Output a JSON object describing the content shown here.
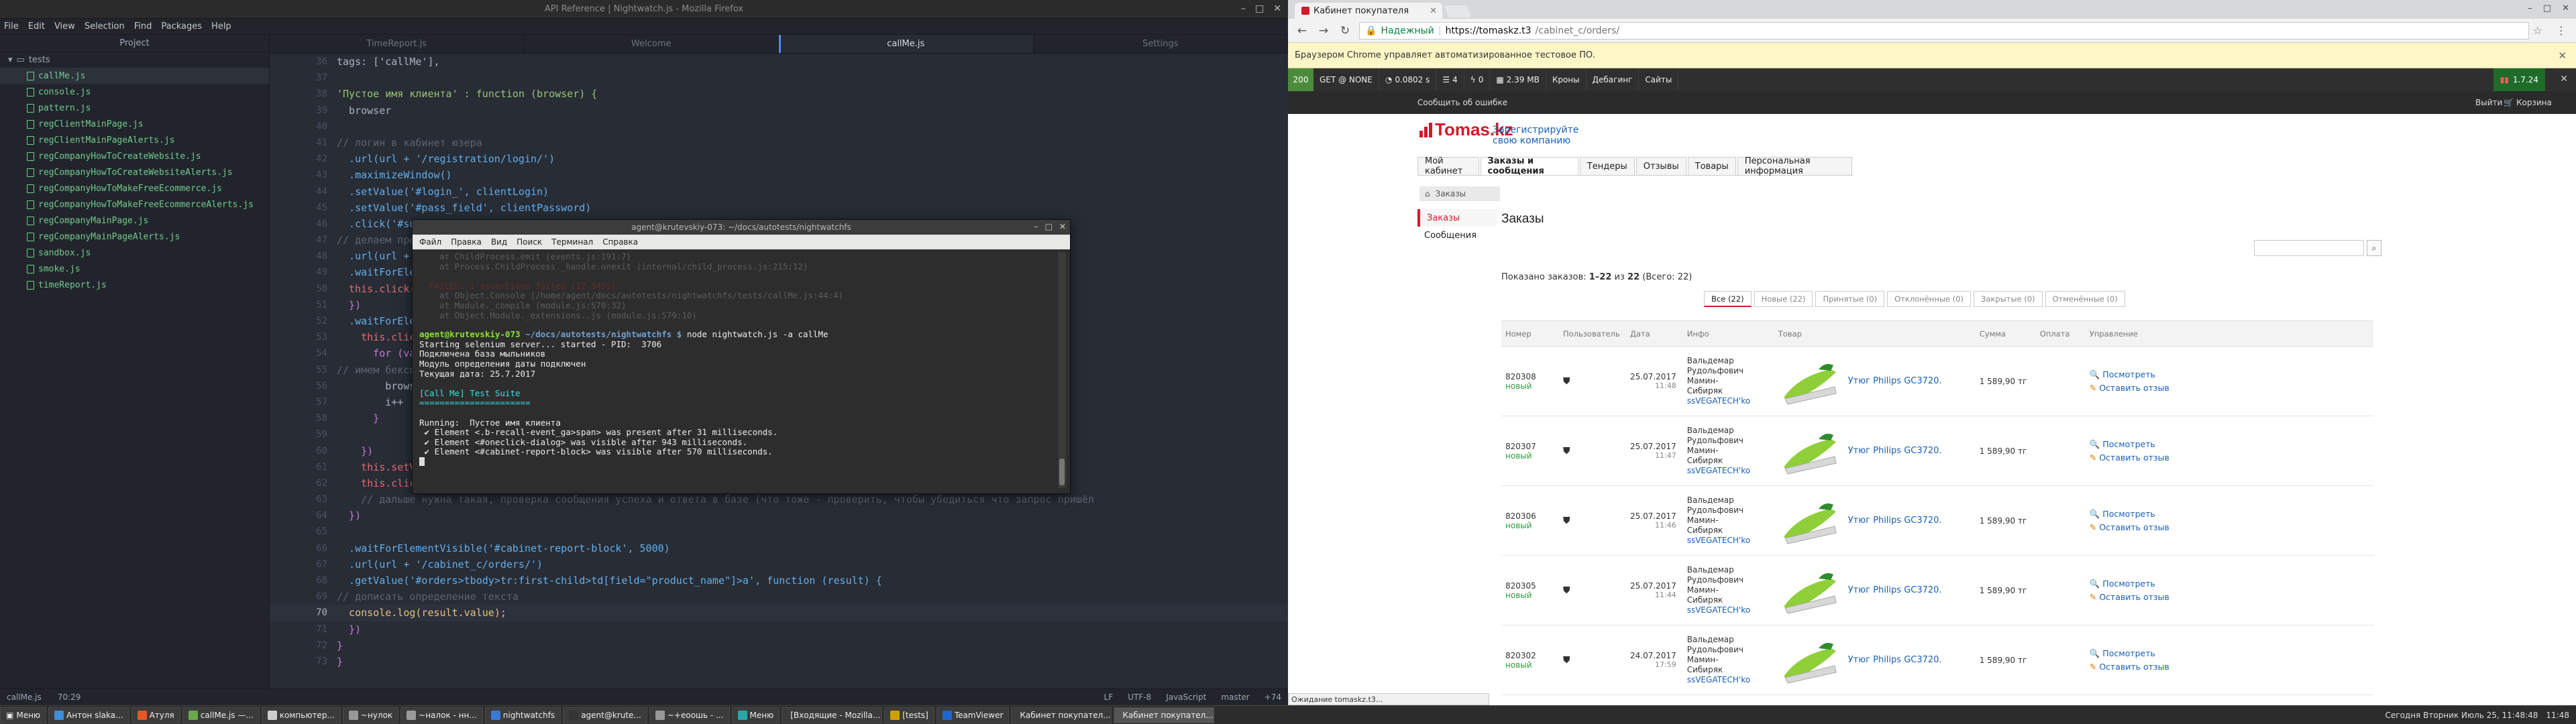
{
  "atom": {
    "title": "API Reference | Nightwatch.js - Mozilla Firefox",
    "menu": [
      "File",
      "Edit",
      "View",
      "Selection",
      "Find",
      "Packages",
      "Help"
    ],
    "tree_header": "Project",
    "tree_folder": "tests",
    "files": [
      "callMe.js",
      "console.js",
      "pattern.js",
      "regClientMainPage.js",
      "regClientMainPageAlerts.js",
      "regCompanyHowToCreateWebsite.js",
      "regCompanyHowToCreateWebsiteAlerts.js",
      "regCompanyHowToMakeFreeEcommerce.js",
      "regCompanyHowToMakeFreeEcommerceAlerts.js",
      "regCompanyMainPage.js",
      "regCompanyMainPageAlerts.js",
      "sandbox.js",
      "smoke.js",
      "timeReport.js"
    ],
    "tabs": [
      "TimeReport.js",
      "Welcome",
      "callMe.js",
      "Settings"
    ],
    "line_numbers": [
      "36",
      "37",
      "38",
      "39",
      "40",
      "41",
      "42",
      "43",
      "44",
      "45",
      "46",
      "47",
      "48",
      "49",
      "50",
      "51",
      "52",
      "53",
      "54",
      "55",
      "56",
      "57",
      "58",
      "59",
      "60",
      "61",
      "62",
      "63",
      "64",
      "65",
      "66",
      "67",
      "68",
      "69",
      "70",
      "71",
      "72",
      "73"
    ],
    "code": [
      "tags: ['callMe'],",
      "",
      "'Пустое имя клиента' : function (browser) {",
      "  browser",
      "",
      "// логин в кабинет юзера",
      "  .url(url + '/registration/login/')",
      "  .maximizeWindow()",
      "  .setValue('#login_', clientLogin)",
      "  .setValue('#pass_field', clientPassword)",
      "  .click('#submi",
      "// делаем провер",
      "  .url(url + targ",
      "  .waitForElement",
      "  this.click('.b",
      "  })",
      "  .waitForElement",
      "    this.click('#",
      "      for (var i",
      "// имем бексплс",
      "        browser.k",
      "        i++",
      "      }",
      "",
      "    })",
      "    this.setValue",
      "    this.click('#",
      "    // дальше нужна такая, проверка сообщения успеха и ответа в базе (что тоже - проверить, чтобы убедиться что запрос пришёл",
      "  })",
      "",
      "  .waitForElementVisible('#cabinet-report-block', 5000)",
      "  .url(url + '/cabinet_c/orders/')",
      "  .getValue('#orders>tbody>tr:first-child>td[field=\"product_name\"]>a', function (result) {",
      "// дописать определение текста",
      "  console.log(result.value);",
      "  })",
      "}",
      "}"
    ],
    "status_left_file": "callMe.js",
    "status_left_pos": "70:29",
    "status_right": [
      "LF",
      "UTF-8",
      "JavaScript",
      "master",
      "+74"
    ]
  },
  "terminal": {
    "title": "agent@krutevskiy-073: ~/docs/autotests/nightwatchfs",
    "menu": [
      "Файл",
      "Правка",
      "Вид",
      "Поиск",
      "Терминал",
      "Справка"
    ],
    "faded_lines": [
      "    at ChildProcess.emit (events.js:191:7)",
      "    at Process.ChildProcess._handle.onexit (internal/child_process.js:215:12)",
      "",
      "  FAILED: 1 assertions failed (12.345s)",
      "    at Object.Console (/home/agent/docs/autotests/nightwatchfs/tests/callMe.js:44:4)",
      "    at Module._compile (module.js:570:32)",
      "    at Object.Module._extensions..js (module.js:579:10)"
    ],
    "prompt_user": "agent@krutevskiy-073",
    "prompt_path": " ~/docs/autotests/nightwatchfs $ ",
    "command": "node nightwatch.js -a callMe",
    "lines": [
      "Starting selenium server... started - PID:  3706",
      "Подключена база мыльников",
      "Модуль определения даты подключен",
      "Текущая дата: 25.7.2017",
      "",
      "[Call Me] Test Suite",
      "======================",
      "",
      "Running:  Пустое имя клиента",
      " ✔ Element <.b-recall-event_ga>span> was present after 31 milliseconds.",
      " ✔ Element <#oneclick-dialog> was visible after 943 milliseconds.",
      " ✔ Element <#cabinet-report-block> was visible after 570 milliseconds."
    ]
  },
  "chrome": {
    "tab_title": "Кабинет покупателя",
    "secure_label": "Надежный",
    "url_host": "https://tomaskz.t3",
    "url_path": "/cabinet_c/orders/",
    "infobar": "Браузером Chrome управляет автоматизированное тестовое ПО.",
    "debug": {
      "code": "200",
      "request": "GET @ NONE",
      "time": "0.0802 s",
      "queries": "4",
      "events": "0",
      "memory": "2.39 MB",
      "routes": "Кроны",
      "debug": "Дебагинг",
      "sites": "Сайты",
      "version": "1.7.24"
    },
    "site": {
      "report_error": "Сообщить об ошибке",
      "logout": "Выйти",
      "cart": "Корзина",
      "logo": "Tomas.kz",
      "register_link_1": "Зарегистрируйте",
      "register_link_2": "свою компанию",
      "nav": [
        "Мой кабинет",
        "Заказы и сообщения",
        "Тендеры",
        "Отзывы",
        "Товары",
        "Персональная информация"
      ],
      "breadcrumb": "Заказы",
      "side": [
        "Заказы",
        "Сообщения"
      ],
      "title": "Заказы",
      "count_prefix": "Показано заказов: ",
      "count_range": "1–22",
      "count_mid": " из ",
      "count_total": "22",
      "count_suffix": " (Всего: 22)",
      "filters": [
        "Все (22)",
        "Новые (22)",
        "Принятые (0)",
        "Отклонённые (0)",
        "Закрытые (0)",
        "Отменённые (0)"
      ],
      "columns": [
        "Номер",
        "Пользователь",
        "Дата",
        "Инфо",
        "Товар",
        "Сумма",
        "Оплата",
        "Управление"
      ],
      "rows": [
        {
          "num": "820308",
          "status": "новый",
          "date": "25.07.2017",
          "time": "11:48",
          "info1": "Вальдемар",
          "info2": "Рудольфович Мамин-",
          "info3": "Сибиряк",
          "info4": "ssVEGATECH'ko",
          "product": "Утюг Philips GC3720.",
          "sum": "1 589,90 тг",
          "a1": "Посмотреть",
          "a2": "Оставить отзыв"
        },
        {
          "num": "820307",
          "status": "новый",
          "date": "25.07.2017",
          "time": "11:47",
          "info1": "Вальдемар",
          "info2": "Рудольфович Мамин-",
          "info3": "Сибиряк",
          "info4": "ssVEGATECH'ko",
          "product": "Утюг Philips GC3720.",
          "sum": "1 589,90 тг",
          "a1": "Посмотреть",
          "a2": "Оставить отзыв"
        },
        {
          "num": "820306",
          "status": "новый",
          "date": "25.07.2017",
          "time": "11:46",
          "info1": "Вальдемар",
          "info2": "Рудольфович Мамин-",
          "info3": "Сибиряк",
          "info4": "ssVEGATECH'ko",
          "product": "Утюг Philips GC3720.",
          "sum": "1 589,90 тг",
          "a1": "Посмотреть",
          "a2": "Оставить отзыв"
        },
        {
          "num": "820305",
          "status": "новый",
          "date": "25.07.2017",
          "time": "11:44",
          "info1": "Вальдемар",
          "info2": "Рудольфович Мамин-",
          "info3": "Сибиряк",
          "info4": "ssVEGATECH'ko",
          "product": "Утюг Philips GC3720.",
          "sum": "1 589,90 тг",
          "a1": "Посмотреть",
          "a2": "Оставить отзыв"
        },
        {
          "num": "820302",
          "status": "новый",
          "date": "24.07.2017",
          "time": "17:59",
          "info1": "Вальдемар",
          "info2": "Рудольфович Мамин-",
          "info3": "Сибиряк",
          "info4": "ssVEGATECH'ko",
          "product": "Утюг Philips GC3720.",
          "sum": "1 589,90 тг",
          "a1": "Посмотреть",
          "a2": "Оставить отзыв"
        }
      ]
    },
    "status_bar": "Ожидание tomaskz.t3..."
  },
  "taskbar": {
    "start": "Меню",
    "items": [
      "Антон slaka...",
      "Атуля",
      "callMe.js —...",
      "компьютер...",
      "~нулок",
      "~налок - нн...",
      "nightwatchfs",
      "agent@krute...",
      "~+еоошь - ...",
      "Меню",
      "[Входящие - Mozilla...",
      "[tests]",
      "TeamViewer",
      "Кабинет покупател...",
      "Кабинет покупател..."
    ],
    "clock": "Сегодня Вторник Июль 25, 11:48:48",
    "clock2": "11:48"
  },
  "colors": {
    "brand_red": "#d11a2a",
    "link_blue": "#1a5fb4",
    "status_green": "#2a9d3c",
    "atom_bg": "#282c34"
  }
}
